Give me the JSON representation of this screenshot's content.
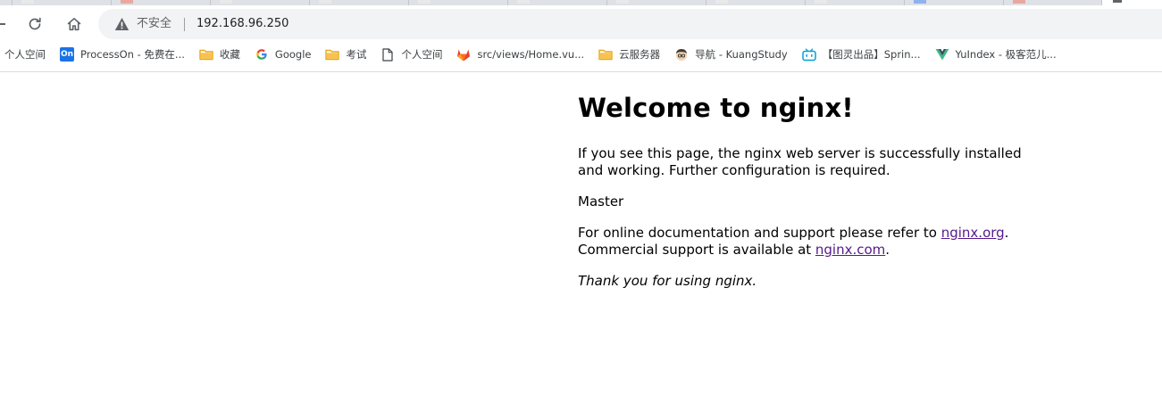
{
  "browser": {
    "address_bar": {
      "security_label": "不安全",
      "url": "192.168.96.250"
    },
    "bookmarks": [
      {
        "label": "个人空间",
        "icon": "none"
      },
      {
        "label": "ProcessOn - 免费在...",
        "icon": "processon-icon"
      },
      {
        "label": "收藏",
        "icon": "folder-icon"
      },
      {
        "label": "Google",
        "icon": "google-icon"
      },
      {
        "label": "考试",
        "icon": "folder-icon"
      },
      {
        "label": "个人空间",
        "icon": "page-icon"
      },
      {
        "label": "src/views/Home.vu...",
        "icon": "gitlab-icon"
      },
      {
        "label": "云服务器",
        "icon": "folder-icon"
      },
      {
        "label": "导航 - KuangStudy",
        "icon": "avatar-icon"
      },
      {
        "label": "【图灵出品】Sprin...",
        "icon": "bilibili-icon"
      },
      {
        "label": "YuIndex - 极客范儿...",
        "icon": "vue-icon"
      }
    ],
    "processon_badge": "On"
  },
  "page": {
    "heading": "Welcome to nginx!",
    "intro": "If you see this page, the nginx web server is successfully installed and working. Further configuration is required.",
    "server_name": "Master",
    "docs_prefix": "For online documentation and support please refer to ",
    "docs_link": "nginx.org",
    "docs_suffix": ".",
    "commercial_prefix": "Commercial support is available at ",
    "commercial_link": "nginx.com",
    "commercial_suffix": ".",
    "thanks": "Thank you for using nginx."
  },
  "colors": {
    "link": "#551a8b",
    "folder": "#f8c24e",
    "processon": "#1a73e8",
    "gitlab": "#e24329",
    "bilibili": "#00a1d6",
    "vue": "#41b883"
  }
}
